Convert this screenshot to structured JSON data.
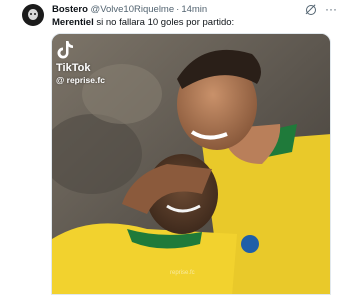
{
  "tweet": {
    "author_name": "Bostero",
    "author_handle": "@Volve10Riquelme",
    "separator": "·",
    "time": "14min",
    "mention": "Merentiel",
    "body": " si no fallara 10 goles por partido:",
    "more_icon": "more-dots-icon",
    "grok_icon": "grok-icon"
  },
  "media": {
    "tiktok_brand": "TikTok",
    "tiktok_handle": "@ reprise.fc",
    "watermark": "reprise.fc",
    "colors": {
      "jersey_yellow": "#f2d22e",
      "jersey_green": "#1f7a3a",
      "background": "#6a6359"
    }
  }
}
